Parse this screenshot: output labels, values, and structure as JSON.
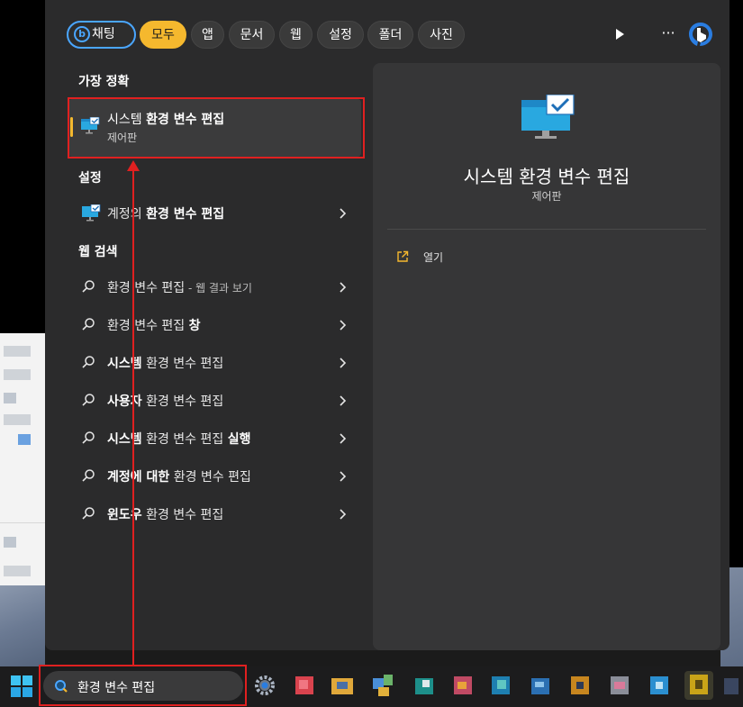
{
  "filters": [
    {
      "label": "채팅"
    },
    {
      "label": "모두"
    },
    {
      "label": "앱"
    },
    {
      "label": "문서"
    },
    {
      "label": "웹"
    },
    {
      "label": "설정"
    },
    {
      "label": "폴더"
    },
    {
      "label": "사진"
    }
  ],
  "filter_more": "···",
  "best_match": {
    "section": "가장 정확",
    "title_prefix": "시스템 ",
    "title_bold": "환경 변수 편집",
    "subtitle": "제어판"
  },
  "settings": {
    "section": "설정",
    "item_prefix": "계정의 ",
    "item_bold": "환경 변수 편집"
  },
  "web": {
    "section": "웹 검색",
    "items": [
      {
        "prefix": "환경 변수 편집",
        "bold": "",
        "suffix": " - 웹 결과 보기"
      },
      {
        "prefix": "환경 변수 편집 ",
        "bold": "창",
        "suffix": ""
      },
      {
        "prefix": "",
        "bold": "시스템",
        "rest": " 환경 변수 편집"
      },
      {
        "prefix": "",
        "bold": "사용자",
        "rest": " 환경 변수 편집"
      },
      {
        "prefix": "",
        "bold": "시스템",
        "rest": " 환경 변수 편집 ",
        "bold2": "실행"
      },
      {
        "prefix": "",
        "bold": "계정에 대한",
        "rest": " 환경 변수 편집"
      },
      {
        "prefix": "",
        "bold": "윈도우",
        "rest": " 환경 변수 편집"
      }
    ]
  },
  "detail": {
    "title": "시스템 환경 변수 편집",
    "subtitle": "제어판",
    "open_label": "열기"
  },
  "taskbar": {
    "search_value": "환경 변수 편집"
  },
  "colors": {
    "accent": "#f5b82e",
    "annotation": "#e02020",
    "bing": "#4aa6ff"
  },
  "icons": [
    "windows-start-icon",
    "search-icon",
    "settings-gear-icon",
    "monitor-check-icon",
    "open-external-icon",
    "chevron-right-icon",
    "bing-icon",
    "play-icon"
  ]
}
